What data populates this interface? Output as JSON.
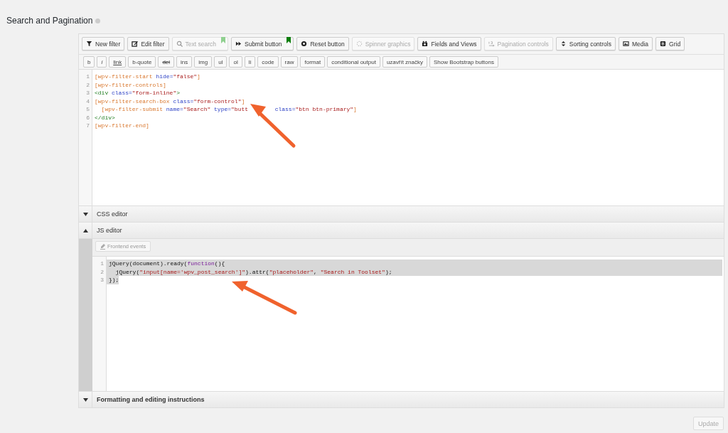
{
  "page_title": "Search and Pagination",
  "toolbar": [
    {
      "label": "New filter",
      "disabled": false,
      "bookmarked": false
    },
    {
      "label": "Edit filter",
      "disabled": false,
      "bookmarked": false
    },
    {
      "label": "Text search",
      "disabled": true,
      "bookmarked": true
    },
    {
      "label": "Submit button",
      "disabled": false,
      "bookmarked": true
    },
    {
      "label": "Reset button",
      "disabled": false,
      "bookmarked": false
    },
    {
      "label": "Spinner graphics",
      "disabled": true,
      "bookmarked": false
    },
    {
      "label": "Fields and Views",
      "disabled": false,
      "bookmarked": false
    },
    {
      "label": "Pagination controls",
      "disabled": true,
      "bookmarked": false
    },
    {
      "label": "Sorting controls",
      "disabled": false,
      "bookmarked": false
    },
    {
      "label": "Media",
      "disabled": false,
      "bookmarked": false
    },
    {
      "label": "Grid",
      "disabled": false,
      "bookmarked": false
    }
  ],
  "quicktags": [
    "b",
    "i",
    "link",
    "b-quote",
    "del",
    "ins",
    "img",
    "ul",
    "ol",
    "li",
    "code",
    "raw",
    "format",
    "conditional output",
    "uzavřít značky",
    "Show Bootstrap buttons"
  ],
  "filter_editor": {
    "lines": [
      {
        "number": "1",
        "tokens": [
          {
            "kind": "shortcode",
            "text": "[wpv-filter-start"
          },
          {
            "kind": "attr",
            "text": " hide="
          },
          {
            "kind": "string",
            "text": "\"false\""
          },
          {
            "kind": "shortcode",
            "text": "]"
          }
        ]
      },
      {
        "number": "2",
        "tokens": [
          {
            "kind": "shortcode",
            "text": "[wpv-filter-controls]"
          }
        ]
      },
      {
        "number": "3",
        "tokens": [
          {
            "kind": "tag",
            "text": "<div"
          },
          {
            "kind": "attr",
            "text": " class="
          },
          {
            "kind": "string",
            "text": "\"form-inline\""
          },
          {
            "kind": "tag",
            "text": ">"
          }
        ]
      },
      {
        "number": "4",
        "tokens": [
          {
            "kind": "shortcode",
            "text": "[wpv-filter-search-box"
          },
          {
            "kind": "attr",
            "text": " class="
          },
          {
            "kind": "string",
            "text": "\"form-control\""
          },
          {
            "kind": "shortcode",
            "text": "]"
          }
        ]
      },
      {
        "number": "5",
        "tokens": [
          {
            "kind": "shortcode",
            "text": "  [wpv-filter-submit"
          },
          {
            "kind": "attr",
            "text": " name="
          },
          {
            "kind": "string",
            "text": "\"Search\""
          },
          {
            "kind": "attr",
            "text": " type="
          },
          {
            "kind": "string",
            "text": "\"butt"
          },
          {
            "kind": "attr",
            "text": "class=",
            "covered_before": true
          },
          {
            "kind": "string",
            "text": "\"btn btn-primary\""
          },
          {
            "kind": "shortcode",
            "text": "]"
          }
        ]
      },
      {
        "number": "6",
        "tokens": [
          {
            "kind": "tag",
            "text": "</div>"
          }
        ]
      },
      {
        "number": "7",
        "tokens": [
          {
            "kind": "shortcode",
            "text": "[wpv-filter-end]"
          }
        ]
      }
    ]
  },
  "sections": [
    {
      "label": "CSS editor",
      "expanded": false
    },
    {
      "label": "JS editor",
      "expanded": true
    }
  ],
  "js_editor": {
    "frontend_events": "Frontend events",
    "lines": [
      {
        "number": "1",
        "selected": true,
        "tokens": [
          {
            "kind": "plain",
            "text": "jQuery(document).ready("
          },
          {
            "kind": "keyword",
            "text": "function"
          },
          {
            "kind": "plain",
            "text": "(){"
          }
        ]
      },
      {
        "number": "2",
        "selected": true,
        "tokens": [
          {
            "kind": "plain",
            "text": "  jQuery("
          },
          {
            "kind": "string",
            "text": "\"input[name='wpv_post_search']\""
          },
          {
            "kind": "plain",
            "text": ").attr("
          },
          {
            "kind": "string",
            "text": "\"placeholder\""
          },
          {
            "kind": "plain",
            "text": ", "
          },
          {
            "kind": "string",
            "text": "\"Search in Toolset\""
          },
          {
            "kind": "plain",
            "text": ");"
          }
        ]
      },
      {
        "number": "3",
        "selected": true,
        "tokens": [
          {
            "kind": "plain",
            "text": "});"
          }
        ]
      }
    ]
  },
  "instructions": {
    "label": "Formatting and editing instructions",
    "expanded": false
  },
  "update_button": {
    "label": "Update",
    "disabled": true
  }
}
